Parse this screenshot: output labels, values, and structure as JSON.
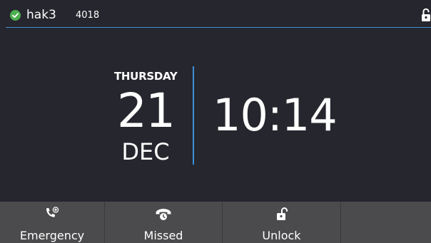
{
  "status_bar": {
    "account_name": "hak3",
    "extension": "4018",
    "registration_icon": "check-circle-icon",
    "registration_color": "#4caf50",
    "lock_icon": "unlocked-padlock-icon",
    "accent_color": "#3f8fd8"
  },
  "datetime": {
    "weekday": "THURSDAY",
    "day": "21",
    "month": "DEC",
    "time": "10:14"
  },
  "softkeys": [
    {
      "label": "Emergency",
      "icon": "emergency-call-icon"
    },
    {
      "label": "Missed",
      "icon": "missed-call-icon"
    },
    {
      "label": "Unlock",
      "icon": "unlock-icon"
    },
    {
      "label": "",
      "icon": ""
    }
  ]
}
